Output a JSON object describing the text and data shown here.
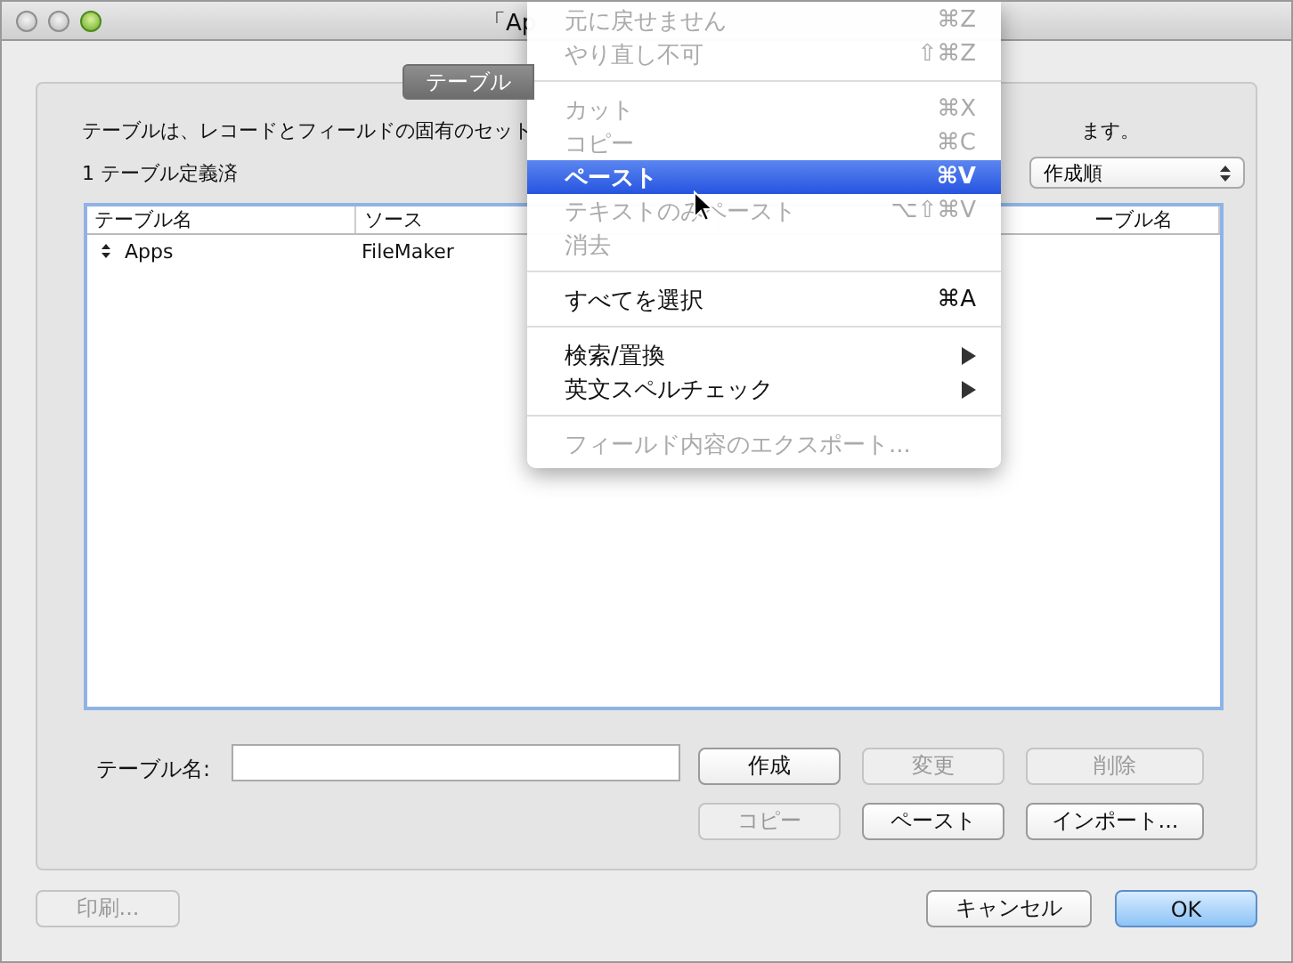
{
  "window": {
    "title": "「Ap"
  },
  "tabs": [
    {
      "label": "テーブル",
      "selected": true
    }
  ],
  "description": {
    "start": "テーブルは、レコードとフィールドの固有のセット",
    "end": "ます。"
  },
  "count": "1 テーブル定義済",
  "sort": {
    "value": "作成順"
  },
  "table": {
    "columns": [
      "テーブル名",
      "ソース",
      "ーブル名"
    ],
    "rows": [
      {
        "cells": [
          "Apps",
          "FileMaker"
        ]
      }
    ]
  },
  "name_field": {
    "label": "テーブル名:"
  },
  "action_buttons": [
    {
      "label": "作成",
      "disabled": false
    },
    {
      "label": "変更",
      "disabled": true
    },
    {
      "label": "削除",
      "disabled": true
    },
    {
      "label": "コピー",
      "disabled": true
    },
    {
      "label": "ペースト",
      "disabled": false
    },
    {
      "label": "インポート...",
      "disabled": false
    }
  ],
  "footer": {
    "print": {
      "label": "印刷...",
      "disabled": true
    },
    "cancel": "キャンセル",
    "ok": "OK"
  },
  "menu": [
    {
      "kind": "item",
      "label": "元に戻せません",
      "shortcut": "⌘Z",
      "disabled": true,
      "selected": false
    },
    {
      "kind": "item",
      "label": "やり直し不可",
      "shortcut": "⇧⌘Z",
      "disabled": true,
      "selected": false
    },
    {
      "kind": "separator"
    },
    {
      "kind": "item",
      "label": "カット",
      "shortcut": "⌘X",
      "disabled": true,
      "selected": false
    },
    {
      "kind": "item",
      "label": "コピー",
      "shortcut": "⌘C",
      "disabled": true,
      "selected": false
    },
    {
      "kind": "item",
      "label": "ペースト",
      "shortcut": "⌘V",
      "disabled": false,
      "selected": true
    },
    {
      "kind": "item",
      "label": "テキストのみペースト",
      "shortcut": "⌥⇧⌘V",
      "disabled": true,
      "selected": false
    },
    {
      "kind": "item",
      "label": "消去",
      "disabled": true,
      "selected": false
    },
    {
      "kind": "separator"
    },
    {
      "kind": "item",
      "label": "すべてを選択",
      "shortcut": "⌘A",
      "disabled": false,
      "selected": false
    },
    {
      "kind": "separator"
    },
    {
      "kind": "submenu",
      "label": "検索/置換",
      "disabled": false,
      "selected": false
    },
    {
      "kind": "submenu",
      "label": "英文スペルチェック",
      "disabled": false,
      "selected": false
    },
    {
      "kind": "separator"
    },
    {
      "kind": "item",
      "label": "フィールド内容のエクスポート...",
      "disabled": true,
      "selected": false
    }
  ]
}
